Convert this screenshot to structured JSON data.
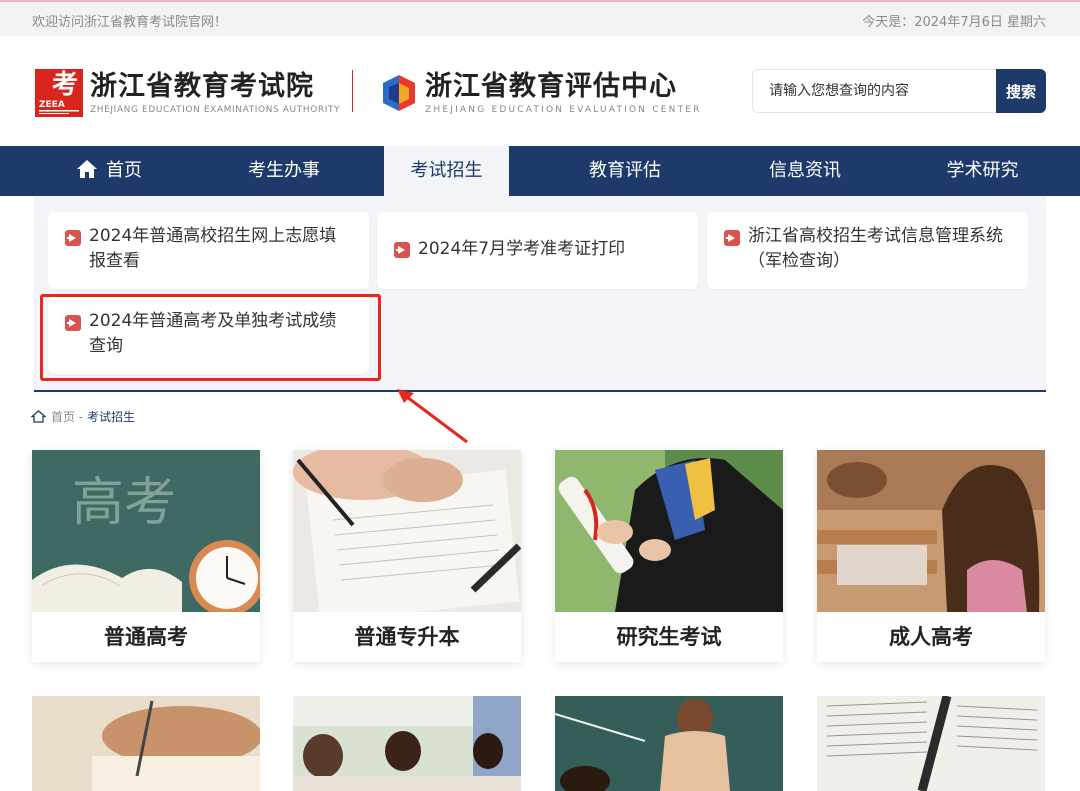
{
  "topbar": {
    "welcome": "欢迎访问浙江省教育考试院官网！",
    "today": "今天是：2024年7月6日 星期六"
  },
  "header": {
    "org1": {
      "name": "浙江省教育考试院",
      "en": "ZHEJIANG EDUCATION EXAMINATIONS AUTHORITY",
      "logo_text": "考",
      "logo_badge": "ZEEA"
    },
    "org2": {
      "name": "浙江省教育评估中心",
      "en": "ZHEJIANG EDUCATION EVALUATION CENTER"
    },
    "search": {
      "placeholder": "请输入您想查询的内容",
      "button": "搜索"
    }
  },
  "nav": [
    {
      "label": "首页",
      "icon": "home-icon"
    },
    {
      "label": "考生办事"
    },
    {
      "label": "考试招生",
      "active": true
    },
    {
      "label": "教育评估"
    },
    {
      "label": "信息资讯"
    },
    {
      "label": "学术研究"
    }
  ],
  "dropdown": [
    {
      "label": "2024年普通高校招生网上志愿填报查看"
    },
    {
      "label": "2024年7月学考准考证打印"
    },
    {
      "label": "浙江省高校招生考试信息管理系统（军检查询）"
    },
    {
      "label": "2024年普通高考及单独考试成绩查询",
      "highlighted": true
    }
  ],
  "breadcrumb": {
    "home": "首页",
    "sep": " - ",
    "current": "考试招生"
  },
  "tiles": [
    {
      "label": "普通高考",
      "image": "gaokao-classroom-clock"
    },
    {
      "label": "普通专升本",
      "image": "student-writing-exam"
    },
    {
      "label": "研究生考试",
      "image": "graduate-diploma"
    },
    {
      "label": "成人高考",
      "image": "adult-students-classroom"
    }
  ],
  "tiles_row2": [
    {
      "image": "hand-writing"
    },
    {
      "image": "students-exam-hall"
    },
    {
      "image": "teacher-pointer"
    },
    {
      "image": "pen-on-book"
    }
  ],
  "colors": {
    "navy": "#1e3a6b",
    "accent_red": "#d9534f",
    "highlight_red": "#e8261f"
  }
}
